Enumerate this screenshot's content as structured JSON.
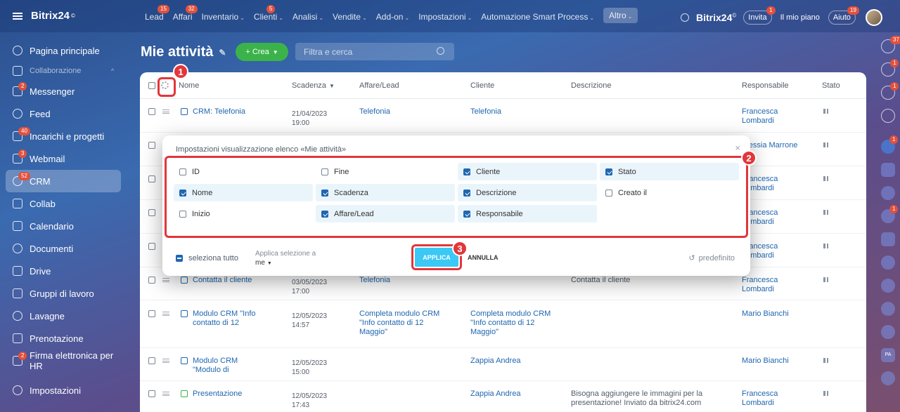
{
  "topbar": {
    "brand": "Bitrix24",
    "brand_mark": "©",
    "nav": [
      {
        "label": "Lead",
        "badge": "15"
      },
      {
        "label": "Affari",
        "badge": "32"
      },
      {
        "label": "Inventario",
        "chevron": true
      },
      {
        "label": "Clienti",
        "chevron": true,
        "badge": "5"
      },
      {
        "label": "Analisi",
        "chevron": true
      },
      {
        "label": "Vendite",
        "chevron": true
      },
      {
        "label": "Add-on",
        "chevron": true
      },
      {
        "label": "Impostazioni",
        "chevron": true
      },
      {
        "label": "Automazione Smart Process",
        "chevron": true
      },
      {
        "label": "Altro",
        "chevron": true,
        "active": true
      }
    ],
    "brand_right": "Bitrix24",
    "invite": "Invita",
    "invite_badge": "1",
    "plan": "Il mio piano",
    "help": "Aiuto",
    "help_badge": "19"
  },
  "sidebar": {
    "items": [
      {
        "label": "Pagina principale"
      },
      {
        "label": "Collaborazione",
        "section": true
      },
      {
        "label": "Messenger",
        "badge": "2"
      },
      {
        "label": "Feed"
      },
      {
        "label": "Incarichi e progetti",
        "badge": "40"
      },
      {
        "label": "Webmail",
        "badge": "3"
      },
      {
        "label": "CRM",
        "badge": "52",
        "active": true
      },
      {
        "label": "Collab"
      },
      {
        "label": "Calendario"
      },
      {
        "label": "Documenti"
      },
      {
        "label": "Drive"
      },
      {
        "label": "Gruppi di lavoro"
      },
      {
        "label": "Lavagne"
      },
      {
        "label": "Prenotazione"
      },
      {
        "label": "Firma elettronica per HR",
        "badge": "2"
      },
      {
        "label": "Impostazioni"
      }
    ]
  },
  "rail": {
    "badges": [
      "37",
      "1",
      "1",
      "",
      "1",
      "",
      "",
      "1",
      "",
      "",
      "",
      "",
      "",
      "PA",
      ""
    ]
  },
  "page": {
    "title": "Mie attività",
    "create": "+ Crea",
    "filter_placeholder": "Filtra e cerca"
  },
  "grid": {
    "headers": {
      "name": "Nome",
      "deadline": "Scadenza",
      "deal": "Affare/Lead",
      "client": "Cliente",
      "description": "Descrizione",
      "responsible": "Responsabile",
      "status": "Stato"
    },
    "rows": [
      {
        "name": "CRM: Telefonia",
        "date": "21/04/2023",
        "time": "19:00",
        "deal": "Telefonia",
        "client": "Telefonia",
        "desc": "",
        "resp1": "Francesca",
        "resp2": "Lombardi",
        "icon": "task"
      },
      {
        "name": "",
        "date": "",
        "time": "",
        "deal": "",
        "client": "",
        "desc": "",
        "resp1": "Alessia Marrone",
        "resp2": "",
        "icon": "task"
      },
      {
        "name": "",
        "date": "",
        "time": "",
        "deal": "",
        "client": "",
        "desc": "",
        "resp1": "Francesca",
        "resp2": "Lombardi",
        "icon": "task"
      },
      {
        "name": "",
        "date": "",
        "time": "",
        "deal": "",
        "client": "",
        "desc": "",
        "resp1": "Francesca",
        "resp2": "Lombardi",
        "icon": "task"
      },
      {
        "name": "",
        "date": "",
        "time": "",
        "deal": "",
        "client": "",
        "desc": "",
        "resp1": "Francesca",
        "resp2": "Lombardi",
        "icon": "task"
      },
      {
        "name": "Contatta il cliente",
        "date": "03/05/2023",
        "time": "17:00",
        "deal": "Telefonia",
        "client": "",
        "desc": "Contatta il cliente",
        "resp1": "Francesca",
        "resp2": "Lombardi",
        "icon": "task"
      },
      {
        "name": "Modulo CRM \"Info",
        "name2": "contatto di 12",
        "date": "12/05/2023",
        "time": "14:57",
        "deal": "Completa modulo CRM",
        "deal2": "\"Info contatto di 12",
        "deal3": "Maggio\"",
        "client": "Completa modulo CRM",
        "client2": "\"Info contatto di 12",
        "client3": "Maggio\"",
        "desc": "",
        "resp1": "Mario Bianchi",
        "resp2": "",
        "icon": "form"
      },
      {
        "name": "Modulo CRM",
        "name2": "\"Modulo di",
        "date": "12/05/2023",
        "time": "15:00",
        "deal": "",
        "client": "Zappia Andrea",
        "desc": "",
        "resp1": "Mario Bianchi",
        "resp2": "",
        "icon": "form"
      },
      {
        "name": "Presentazione",
        "date": "12/05/2023",
        "time": "17:43",
        "deal": "",
        "client": "Zappia Andrea",
        "desc": "Bisogna aggiungere le immagini per la",
        "desc2": "presentazione! Inviato da bitrix24.com",
        "resp1": "Francesca",
        "resp2": "Lombardi",
        "icon": "mail"
      }
    ]
  },
  "modal": {
    "title": "Impostazioni visualizzazione elenco «Mie attività»",
    "options": [
      [
        "ID",
        false
      ],
      [
        "Fine",
        false
      ],
      [
        "Cliente",
        true
      ],
      [
        "Stato",
        true
      ],
      [
        "Nome",
        true
      ],
      [
        "Scadenza",
        true
      ],
      [
        "Descrizione",
        true
      ],
      [
        "Creato il",
        false
      ],
      [
        "Inizio",
        false
      ],
      [
        "Affare/Lead",
        true
      ],
      [
        "Responsabile",
        true
      ]
    ],
    "select_all": "seleziona tutto",
    "apply_to": "Applica selezione a",
    "apply_to_value": "me",
    "apply": "APPLICA",
    "cancel": "ANNULLA",
    "default": "predefinito"
  },
  "markers": [
    "1",
    "2",
    "3"
  ]
}
